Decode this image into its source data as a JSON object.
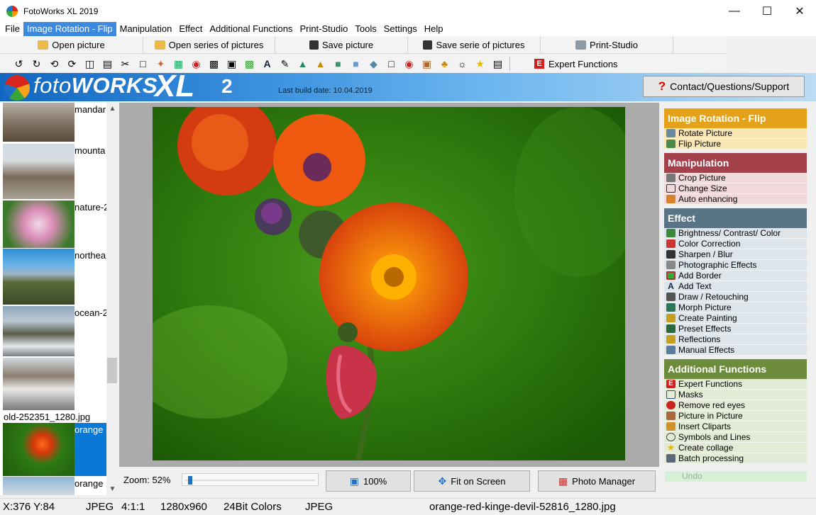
{
  "window": {
    "title": "FotoWorks XL 2019"
  },
  "menu": [
    "File",
    "Image Rotation - Flip",
    "Manipulation",
    "Effect",
    "Additional Functions",
    "Print-Studio",
    "Tools",
    "Settings",
    "Help"
  ],
  "toolbar": {
    "open": "Open picture",
    "open_series": "Open series of pictures",
    "save": "Save picture",
    "save_series": "Save serie of pictures",
    "print": "Print-Studio",
    "expert": "Expert Functions"
  },
  "banner": {
    "logo_a": "foto",
    "logo_b": "WORKS",
    "logo_xl": "XL",
    "logo_ver": "2",
    "build": "Last build date: 10.04.2019",
    "contact": "Contact/Questions/Support"
  },
  "thumbnails": [
    {
      "name": "mandar"
    },
    {
      "name": "mounta"
    },
    {
      "name": "nature-2"
    },
    {
      "name": "northea"
    },
    {
      "name": "ocean-2"
    },
    {
      "name": "old-252351_1280.jpg"
    },
    {
      "name": "orange"
    },
    {
      "name": "orange"
    }
  ],
  "zoom": {
    "label": "Zoom: 52%",
    "level_percent": 52,
    "btn_100": "100%",
    "btn_fit": "Fit on Screen",
    "btn_manager": "Photo Manager"
  },
  "panel": {
    "groups": [
      {
        "title": "Image Rotation - Flip",
        "color": "#e3a21a",
        "bg": "#fbe7b5",
        "items": [
          "Rotate Picture",
          "Flip Picture"
        ]
      },
      {
        "title": "Manipulation",
        "color": "#a3404a",
        "bg": "#f1d8da",
        "items": [
          "Crop Picture",
          "Change Size",
          "Auto enhancing"
        ]
      },
      {
        "title": "Effect",
        "color": "#5a7487",
        "bg": "#dde4ea",
        "items": [
          "Brightness/ Contrast/ Color",
          "Color Correction",
          "Sharpen / Blur",
          "Photographic Effects",
          "Add Border",
          "Add Text",
          "Draw / Retouching",
          "Morph Picture",
          "Create Painting",
          "Preset Effects",
          "Reflections",
          "Manual Effects"
        ]
      },
      {
        "title": "Additional Functions",
        "color": "#6c8c3c",
        "bg": "#e3ead6",
        "items": [
          "Expert Functions",
          "Masks",
          "Remove red eyes",
          "Picture in Picture",
          "Insert Cliparts",
          "Symbols and Lines",
          "Create collage",
          "Batch processing"
        ]
      }
    ],
    "undo": "Undo"
  },
  "status": {
    "coords": "X:376 Y:84",
    "format": "JPEG",
    "ratio": "4:1:1",
    "size": "1280x960",
    "colors": "24Bit Colors",
    "type": "JPEG",
    "filename": "orange-red-kinge-devil-52816_1280.jpg"
  }
}
